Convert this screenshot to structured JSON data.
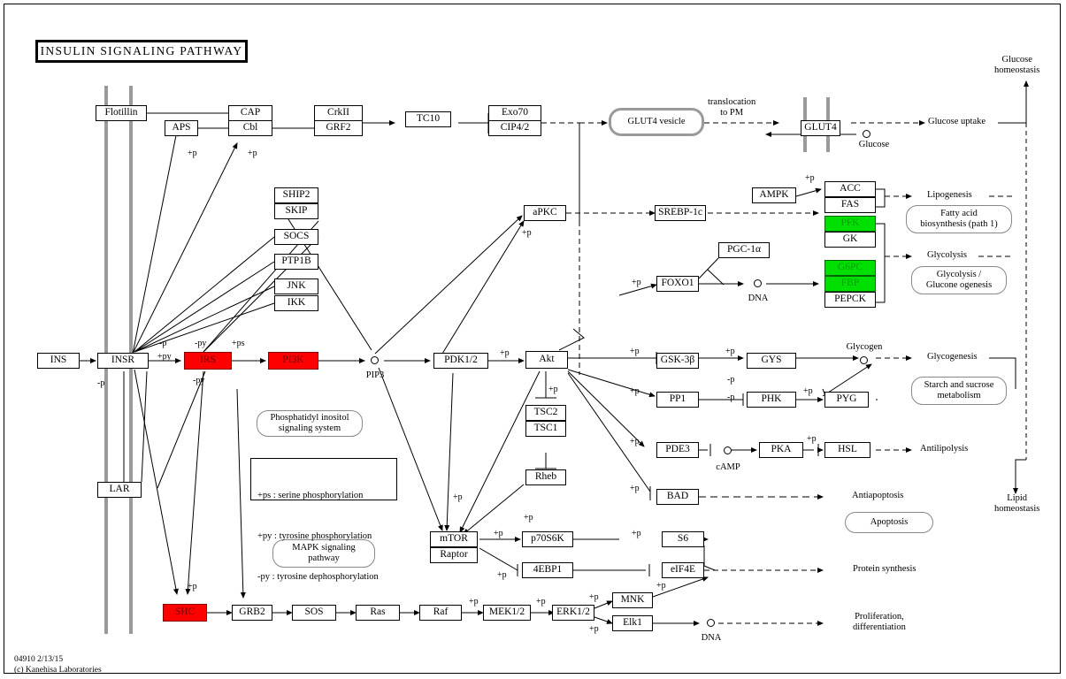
{
  "title": "INSULIN  SIGNALING  PATHWAY",
  "footer": {
    "id_date": "04910 2/13/15",
    "copyright": "(c) Kanehisa Laboratories"
  },
  "colors": {
    "red_node": "#ff0000",
    "green_node": "#00e000",
    "membrane": "#9a9a9a",
    "line": "#000000",
    "background": "#ffffff"
  },
  "nodes": {
    "flotillin": "Flotillin",
    "aps": "APS",
    "cap": "CAP",
    "cbl": "Cbl",
    "crkii": "CrkII",
    "grf2": "GRF2",
    "tc10": "TC10",
    "exo70": "Exo70",
    "cip42": "CIP4/2",
    "glut4_vesicle": "GLUT4 vesicle",
    "glut4": "GLUT4",
    "ship2": "SHIP2",
    "skip": "SKIP",
    "socs": "SOCS",
    "ptp1b": "PTP1B",
    "jnk": "JNK",
    "ikk": "IKK",
    "apkc": "aPKC",
    "srebp1c": "SREBP-1c",
    "ampk": "AMPK",
    "acc": "ACC",
    "fas": "FAS",
    "pfk": "PFK",
    "gk": "GK",
    "g6pc": "G6PC",
    "fbp": "FBP",
    "pepck": "PEPCK",
    "pgc1a": "PGC-1α",
    "foxo1": "FOXO1",
    "ins": "INS",
    "insr": "INSR",
    "irs": "IRS",
    "pi3k": "PI3K",
    "pdk12": "PDK1/2",
    "akt": "Akt",
    "gsk3b": "GSK-3β",
    "gys": "GYS",
    "pp1": "PP1",
    "phk": "PHK",
    "pyg": "PYG",
    "pde3": "PDE3",
    "pka": "PKA",
    "hsl": "HSL",
    "bad": "BAD",
    "tsc2": "TSC2",
    "tsc1": "TSC1",
    "rheb": "Rheb",
    "mtor": "mTOR",
    "raptor": "Raptor",
    "p70s6k": "p70S6K",
    "s6": "S6",
    "e4bp1": "4EBP1",
    "eif4e": "eIF4E",
    "lar": "LAR",
    "shc": "SHC",
    "grb2": "GRB2",
    "sos": "SOS",
    "ras": "Ras",
    "raf": "Raf",
    "mek12": "MEK1/2",
    "erk12": "ERK1/2",
    "mnk": "MNK",
    "elk1": "Elk1"
  },
  "mapboxes": {
    "fatty_acid": [
      "Fatty acid",
      "biosynthesis (path 1)"
    ],
    "glycolysis_gluconeo": [
      "Glycolysis /",
      "Glucone ogenesis"
    ],
    "starch_sucrose": [
      "Starch and sucrose",
      "metabolism"
    ],
    "apoptosis": [
      "Apoptosis"
    ],
    "pi_signaling": [
      "Phosphatidyl inositol",
      "signaling system"
    ],
    "mapk_signaling": [
      "MAPK signaling",
      "pathway"
    ]
  },
  "compound_labels": {
    "glucose": "Glucose",
    "pip3": "PIP3",
    "dna_foxo1": "DNA",
    "glycogen": "Glycogen",
    "camp": "cAMP",
    "dna_elk1": "DNA"
  },
  "process_labels": {
    "translocation_to_pm": [
      "translocation",
      "to PM"
    ],
    "glucose_uptake": "Glucose uptake",
    "glucose_homeostasis": [
      "Glucose",
      "homeostasis"
    ],
    "lipogenesis": "Lipogenesis",
    "glycolysis": "Glycolysis",
    "glycogenesis": "Glycogenesis",
    "antilipolysis": "Antilipolysis",
    "antiapoptosis": "Antiapoptosis",
    "protein_synthesis": "Protein synthesis",
    "proliferation_differentiation": [
      "Proliferation,",
      "differentiation"
    ],
    "lipid_homeostasis": [
      "Lipid",
      "homeostasis"
    ]
  },
  "legend": {
    "lines": [
      "+ps : serine phosphorylation",
      "+py : tyrosine phosphorylation",
      "-py : tyrosine dephosphorylation"
    ]
  },
  "edge_labels": {
    "p_aps": "+p",
    "p_cbl": "+p",
    "p_apkc": "+p",
    "p_acc": "+p",
    "p_foxo1": "+p",
    "p_insr_minus": "-p",
    "p_insr_plus_py": "+py",
    "p_irs_minus_py_top": "-py",
    "p_irs_plus_ps": "+ps",
    "p_irs_minus_py_bottom": "-py",
    "p_insr_minus_bottom": "-p",
    "p_pdk12": "+p",
    "p_akt": "+p",
    "p_gsk3b": "+p",
    "p_gys": "+p",
    "p_pp1": "+p",
    "p_phk_minus": "-p",
    "p_pyg_minus": "-p",
    "p_phk": "+p",
    "p_pde3": "+p",
    "p_hsl": "+p",
    "p_bad": "+p",
    "p_tsc2": "+p",
    "p_mtor_a": "+p",
    "p_mtor_b": "+p",
    "p_p70s6k": "+p",
    "p_s6": "+p",
    "p_4ebp1": "+p",
    "p_eif4e": "+p",
    "p_shc": "+p",
    "p_mek12": "+p",
    "p_erk12": "+p",
    "p_mnk": "+p",
    "p_elk1": "+p"
  }
}
